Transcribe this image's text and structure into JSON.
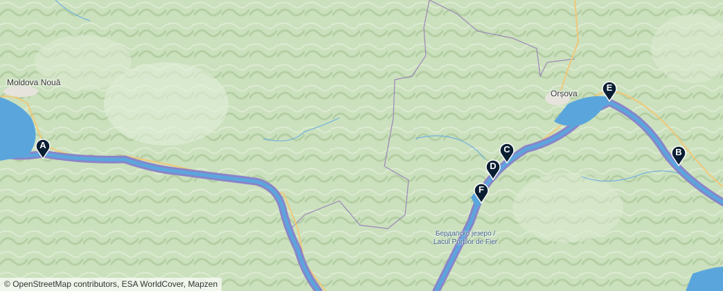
{
  "map": {
    "places": {
      "moldova_noua": "Moldova Nouă",
      "orsova": "Orșova",
      "lake": "Бердапско језеро /\nLacul Porților de Fier"
    },
    "markers": [
      {
        "label": "A"
      },
      {
        "label": "B"
      },
      {
        "label": "C"
      },
      {
        "label": "D"
      },
      {
        "label": "E"
      },
      {
        "label": "F"
      }
    ],
    "marker_color": "#0b1f33",
    "river_color": "#8a84c9",
    "water_color": "#5aa6dc",
    "attribution": {
      "copyright": "©",
      "osm": "OpenStreetMap contributors",
      "sep1": ", ",
      "esa": "ESA WorldCover",
      "sep2": ", ",
      "mapzen": "Mapzen"
    }
  }
}
